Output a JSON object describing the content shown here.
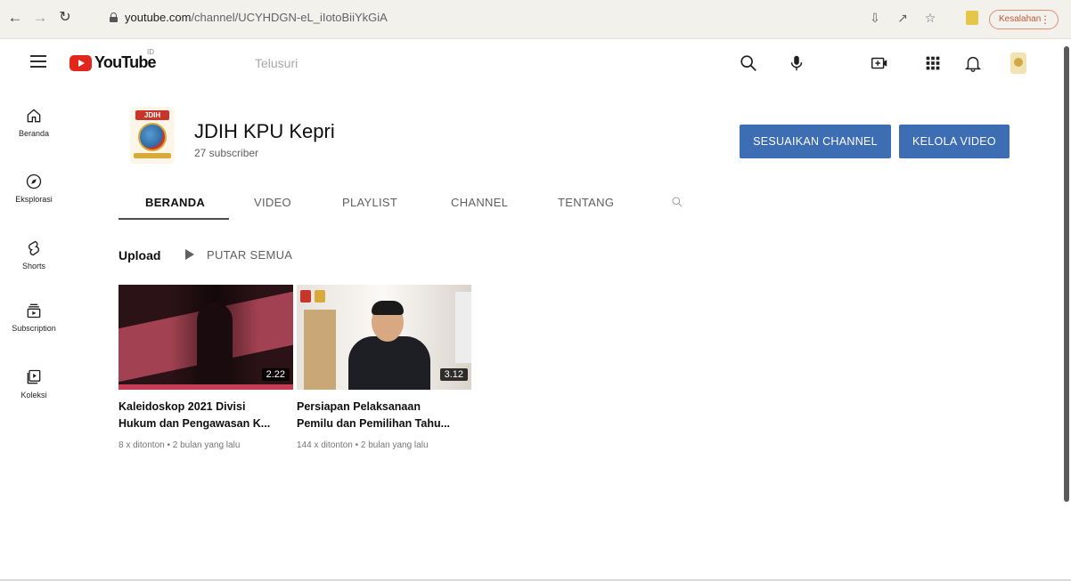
{
  "browser": {
    "url_domain": "youtube.com",
    "url_path": "/channel/UCYHDGN-eL_iIotoBiiYkGiA",
    "profile_label": "Kesalahan",
    "icons": [
      "back-icon",
      "forward-icon",
      "reload-icon",
      "lock-icon",
      "install-icon",
      "share-icon",
      "star-icon",
      "extension-icon",
      "kebab-icon"
    ]
  },
  "masthead": {
    "logo_text": "YouTube",
    "country_code": "ID",
    "search_placeholder": "Telusuri",
    "icons": [
      "hamburger-icon",
      "search-icon",
      "mic-icon",
      "create-icon",
      "apps-icon",
      "bell-icon"
    ]
  },
  "guide": {
    "items": [
      {
        "label": "Beranda",
        "icon": "home-icon"
      },
      {
        "label": "Eksplorasi",
        "icon": "compass-icon"
      },
      {
        "label": "Shorts",
        "icon": "shorts-icon"
      },
      {
        "label": "Subscription",
        "icon": "subscriptions-icon"
      },
      {
        "label": "Koleksi",
        "icon": "library-icon"
      }
    ]
  },
  "channel": {
    "avatar_text": "JDIH",
    "name": "JDIH KPU Kepri",
    "subscribers": "27 subscriber",
    "customize_label": "SESUAIKAN CHANNEL",
    "manage_label": "KELOLA VIDEO"
  },
  "tabs": [
    {
      "label": "BERANDA",
      "active": true
    },
    {
      "label": "VIDEO",
      "active": false
    },
    {
      "label": "PLAYLIST",
      "active": false
    },
    {
      "label": "CHANNEL",
      "active": false
    },
    {
      "label": "TENTANG",
      "active": false
    }
  ],
  "shelf": {
    "title": "Upload",
    "play_all_label": "PUTAR SEMUA"
  },
  "videos": [
    {
      "title": "Kaleidoskop 2021 Divisi Hukum dan Pengawasan K...",
      "duration": "2.22",
      "meta": "8 x ditonton • 2 bulan yang lalu"
    },
    {
      "title": "Persiapan Pelaksanaan Pemilu dan Pemilihan Tahu...",
      "duration": "3.12",
      "meta": "144 x ditonton • 2 bulan yang lalu"
    }
  ],
  "colors": {
    "brand_red": "#e2261c",
    "button_blue": "#3d6db2",
    "text_primary": "#0f0f0f",
    "text_secondary": "#606060"
  }
}
